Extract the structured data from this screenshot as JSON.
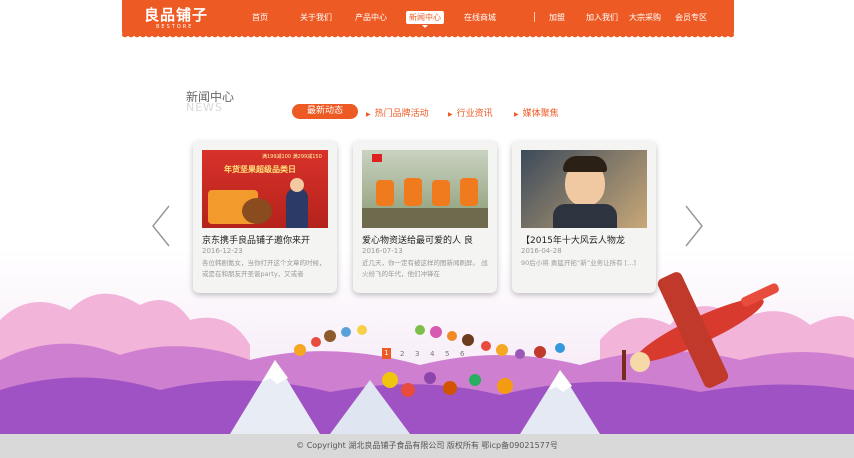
{
  "header": {
    "logo": "良品铺子",
    "logo_sub": "BESTORE",
    "nav": [
      {
        "label": "首页"
      },
      {
        "label": "关于我们"
      },
      {
        "label": "产品中心"
      },
      {
        "label": "新闻中心",
        "active": true
      },
      {
        "label": "在线商城"
      },
      {
        "label": "加盟"
      },
      {
        "label": "加入我们"
      },
      {
        "label": "大宗采购"
      },
      {
        "label": "会员专区"
      }
    ]
  },
  "section": {
    "title": "新闻中心",
    "subtitle": "NEWS",
    "tabs": [
      {
        "label": "最新动态",
        "active": true
      },
      {
        "label": "热门品牌活动"
      },
      {
        "label": "行业资讯"
      },
      {
        "label": "媒体聚焦"
      }
    ]
  },
  "cards": [
    {
      "title": "京东携手良品铺子邀你来开",
      "date": "2016-12-23",
      "desc": "各位韩剧氪女，当你打开这个文章的时候，或是在和朋友开圣诞party，又或者",
      "img_text_1": "年货坚果超级品类日",
      "img_text_2": "满199减100 满299减150"
    },
    {
      "title": "爱心物资送给最可爱的人 良",
      "date": "2016-07-13",
      "desc": "近几天，你一定有被这样的图新闻刷屏。 战火纷飞的年代，他们冲锋在"
    },
    {
      "title": "【2015年十大风云人物龙",
      "date": "2016-04-28",
      "desc": "90后小将 勇猛开拓“新”业务让所有 [...]"
    }
  ],
  "pager": [
    "1",
    "2",
    "3",
    "4",
    "5",
    "6"
  ],
  "pager_active": "1",
  "footer": "© Copyright 湖北良品铺子食品有限公司 版权所有 鄂icp备09021577号",
  "colors": {
    "brand": "#ee5a24",
    "footer_bg": "#d9d9d9"
  }
}
